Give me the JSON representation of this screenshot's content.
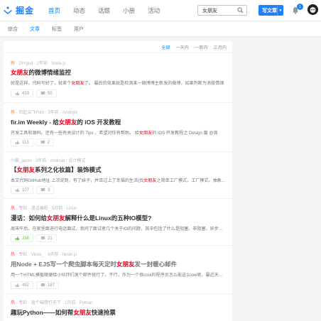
{
  "brand": {
    "name": "掘金",
    "color": "#1e80ff"
  },
  "nav": [
    "首页",
    "动态",
    "话题",
    "小册",
    "活动"
  ],
  "search": {
    "value": "女朋友"
  },
  "write_button": "写文章",
  "notifications": {
    "count": "1"
  },
  "subnav": {
    "items": [
      "综合",
      "文章",
      "标签",
      "用户"
    ],
    "active": 1
  },
  "filters": {
    "items": [
      "全部",
      "一天内",
      "一周内",
      "三月内"
    ],
    "active": 0
  },
  "articles": [
    {
      "tag": "荐",
      "meta": " · DIYgod · 2年前 · Node.js",
      "title_pre": "",
      "title_hl": "女朋友",
      "title_post": "的微博情绪监控",
      "summary_pre": "就是这样，代码写好了，就差个",
      "summary_hl": "女朋友",
      "summary_post": "了。 最后的效果就是检测某一微博博主新发的微博，如果判断为消极情绪",
      "likes": "433",
      "comments": "50"
    },
    {
      "tag": "荐",
      "meta": " · 风起云飞Fitm · 3年前 · Android",
      "title_pre": "fir.im Weekly - 给",
      "title_hl": "女朋友",
      "title_post": "的 iOS 开发教程",
      "summary_pre": "开发工具和源码。还有一些有关设计的 Tips ，希望对你有帮助。 给",
      "summary_hl": "女朋友",
      "summary_post": "的 iOS 开发教程之 Design 篇 @周",
      "likes": "113",
      "comments": "2"
    },
    {
      "tag": "",
      "meta": "小鹏_jason · 3年前 · Android / 设计模式",
      "title_pre": "【",
      "title_hl": "女朋友",
      "title_post": "系列之化妆篇】装饰模式",
      "summary_pre": "本文代码GitHub地址 上次说到，有了妹子，并且过上了幸福的生活(找",
      "summary_hl": "女朋友",
      "summary_post": "之简单工厂模式、工厂模式、抽象...",
      "likes": "107",
      "comments": "3"
    },
    {
      "tag": "热",
      "meta2": "专栏",
      "meta": " · 漫话编程 · 5月前 · Linux",
      "title_pre": "漫话：如何给",
      "title_hl": "女朋友",
      "title_post": "解释什么是Linux的五种IO模型?",
      "summary_pre": "周末午后，在家里面进行电话面试，我问了面试者几个关于IO的问题，其中包括了什么是阻塞、非阻塞、异步...",
      "summary_hl": "",
      "summary_post": "",
      "likes": "238",
      "comments": "21",
      "liked": true
    },
    {
      "tag": "热",
      "meta2": "专栏",
      "meta": " · Vince_ · 8天前 · Node.js",
      "title_pre": "用Node + EJS写一个爬虫脚本每天定时",
      "title_hl": "女朋友",
      "title_post": "发一封暖心邮件",
      "summary_pre": "用一个HTML模板随便给小伙伴们发个邮件就行了，不行，作为一个很cool的程序员怎么能这么low呢。最近天...",
      "summary_hl": "",
      "summary_post": "",
      "likes": "492",
      "comments": "187",
      "read": true
    },
    {
      "tag": "热",
      "meta2": "专栏",
      "meta": " · 逾个喵攒打天下 · 1月前 · Python",
      "title_pre": "趣玩Python——如何帮",
      "title_hl": "女朋友",
      "title_post": "快速抢票",
      "summary_pre": "",
      "summary_hl": "",
      "summary_post": "",
      "likes": "",
      "comments": ""
    }
  ]
}
